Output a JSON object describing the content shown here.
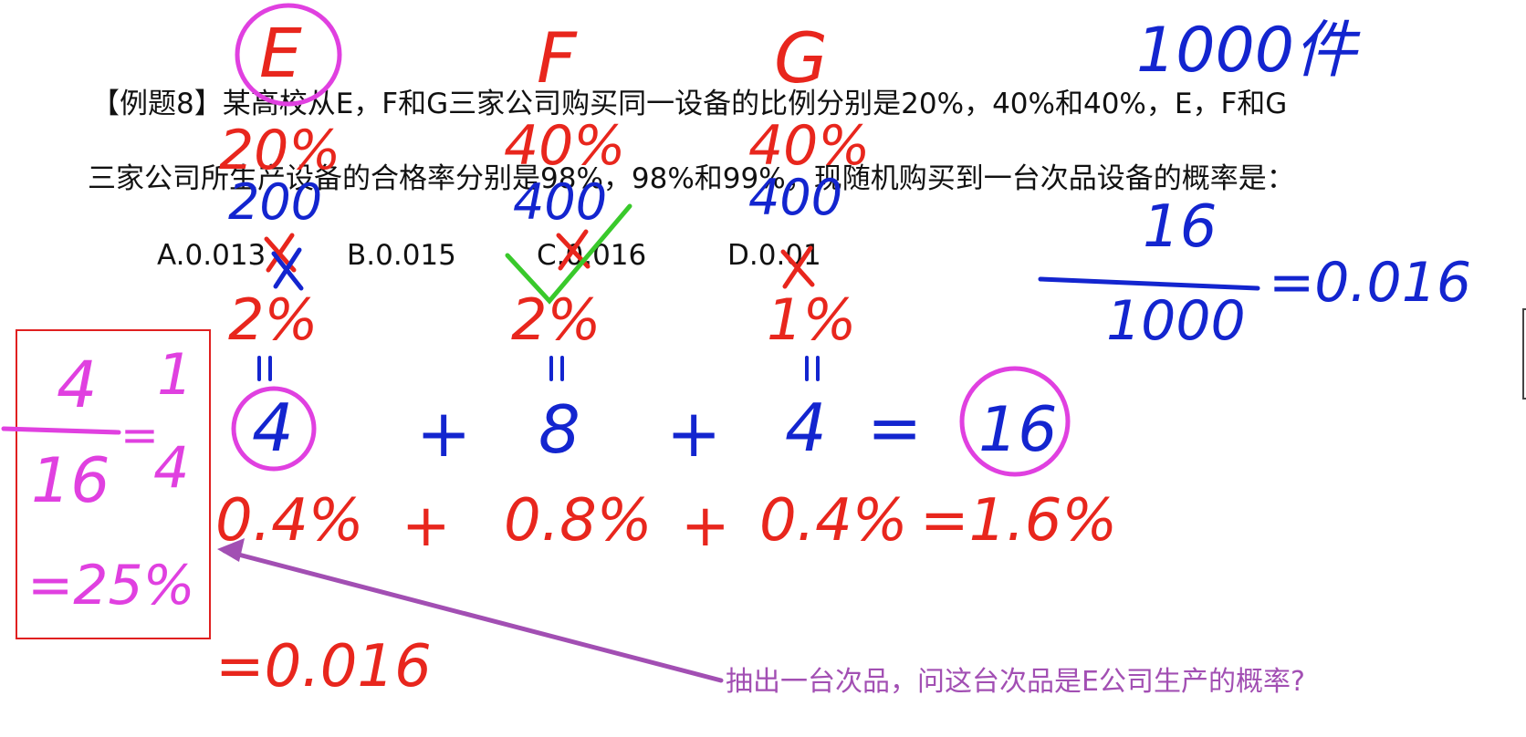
{
  "question": {
    "line1": "【例题8】某高校从E，F和G三家公司购买同一设备的比例分别是20%，40%和40%，E，F和G",
    "line2": "三家公司所生产设备的合格率分别是98%，98%和99%，现随机购买到一台次品设备的概率是：",
    "options": [
      {
        "label": "A.0.013"
      },
      {
        "label": "B.0.015"
      },
      {
        "label": "C.0.016"
      },
      {
        "label": "D.0.01"
      }
    ]
  },
  "follow_up": "抽出一台次品，问这台次品是E公司生产的概率?",
  "annotations": {
    "colors": {
      "magenta": "#e040e0",
      "red": "#e8261d",
      "blue": "#1325cf",
      "green": "#39c92b",
      "purple": "#a24fb3",
      "box": "#e02020"
    },
    "company_labels": [
      "E",
      "F",
      "G"
    ],
    "total_items": "1000件",
    "ratios": [
      "20%",
      "40%",
      "40%"
    ],
    "counts": [
      "200",
      "400",
      "400"
    ],
    "defect_rates": [
      "2%",
      "2%",
      "1%"
    ],
    "defect_counts": [
      "4",
      "8",
      "4"
    ],
    "total_defects": "16",
    "fraction_num": "16",
    "fraction_den": "1000",
    "fraction_result": "=0.016",
    "sum_percent": [
      "0.4%",
      "0.8%",
      "0.4%",
      "=1.6%"
    ],
    "sum_result": "=0.016",
    "box_num": "4",
    "box_den": "16",
    "box_eq1": "1",
    "box_eq2": "4",
    "box_result": "=25%",
    "plus": "+",
    "equals": "="
  }
}
